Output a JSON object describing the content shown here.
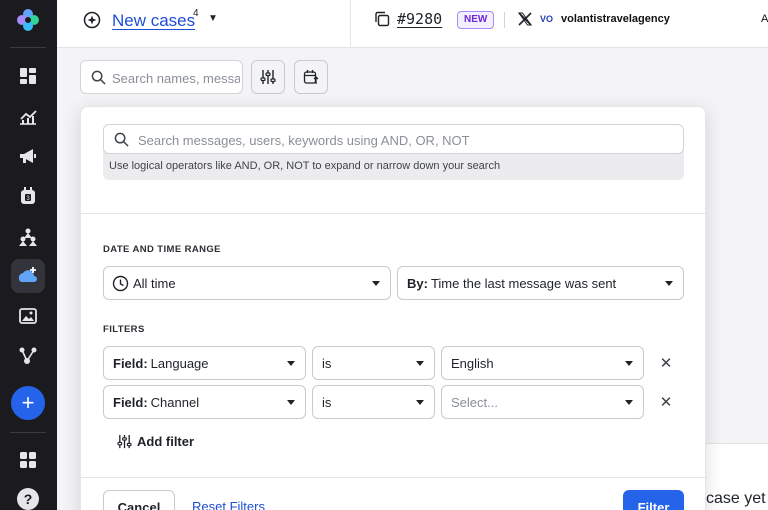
{
  "topbar": {
    "case_title": "New cases",
    "case_count": "4",
    "ticket_id": "#9280",
    "new_badge": "NEW",
    "brand_logo": "VO",
    "brand_name": "volantistravelagency",
    "right_cut": "A"
  },
  "search": {
    "placeholder": "Search names, messages"
  },
  "filter_panel": {
    "keyword_placeholder": "Search messages, users, keywords using AND, OR, NOT",
    "keyword_hint": "Use logical operators like AND, OR, NOT to expand or narrow down your search",
    "date_section_label": "DATE AND TIME RANGE",
    "date_range": "All time",
    "by_label": "By:",
    "by_value": "Time the last message was sent",
    "filters_section_label": "FILTERS",
    "filters": [
      {
        "field_label": "Field:",
        "field": "Language",
        "operator": "is",
        "value": "English",
        "value_is_placeholder": false
      },
      {
        "field_label": "Field:",
        "field": "Channel",
        "operator": "is",
        "value": "Select...",
        "value_is_placeholder": true
      }
    ],
    "remove_glyph": "✕",
    "add_filter": "Add filter",
    "cancel": "Cancel",
    "reset": "Reset Filters",
    "submit": "Filter"
  },
  "right_panel": {
    "text": "case yet"
  },
  "sidebar": {
    "add": "+",
    "help": "?"
  },
  "colors": {
    "sidebar_bg": "#1b1b1f",
    "accent": "#2563eb",
    "link": "#1d4ed8",
    "badge": "#6d28d9"
  }
}
